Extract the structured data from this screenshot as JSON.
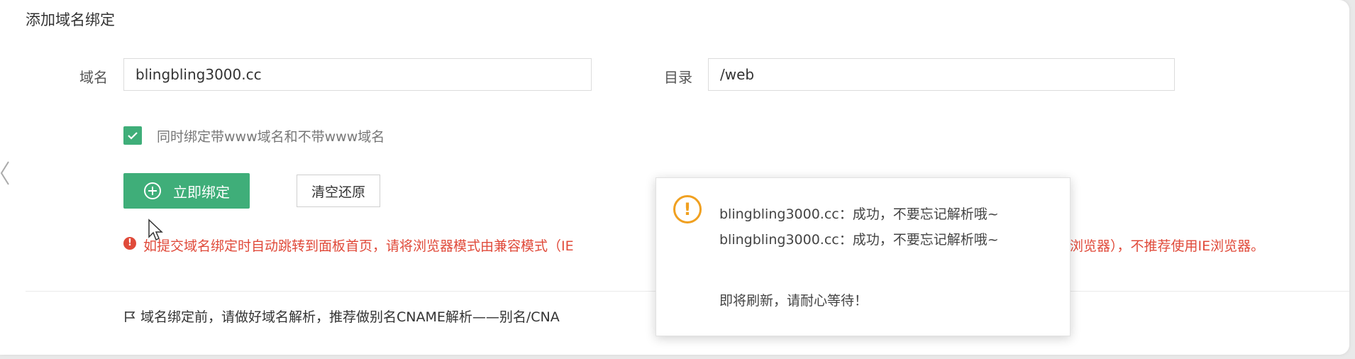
{
  "title": "添加域名绑定",
  "form": {
    "domain_label": "域名",
    "domain_value": "blingbling3000.cc",
    "dir_label": "目录",
    "dir_value": "/web",
    "checkbox_label": "同时绑定带www域名和不带www域名",
    "checkbox_checked": true,
    "bind_button": "立即绑定",
    "reset_button": "清空还原"
  },
  "warning": {
    "text_left": "如提交域名绑定时自动跳转到面板首页，请将浏览器模式由兼容模式（IE",
    "text_right": "浏览器），不推荐使用IE浏览器。"
  },
  "tip": {
    "text": "域名绑定前，请做好域名解析，推荐做别名CNAME解析——别名/CNA"
  },
  "dialog": {
    "line1": "blingbling3000.cc：成功，不要忘记解析哦~",
    "line2": "blingbling3000.cc：成功，不要忘记解析哦~",
    "line3": "即将刷新，请耐心等待！"
  },
  "colors": {
    "primary": "#3fae79",
    "warning_red": "#e04a3a",
    "dialog_icon": "#f0a020"
  },
  "icons": [
    "check-icon",
    "plus-circle-icon",
    "alert-circle-icon",
    "flag-icon",
    "exclamation-icon",
    "mouse-cursor-icon",
    "chevron-left-icon"
  ]
}
